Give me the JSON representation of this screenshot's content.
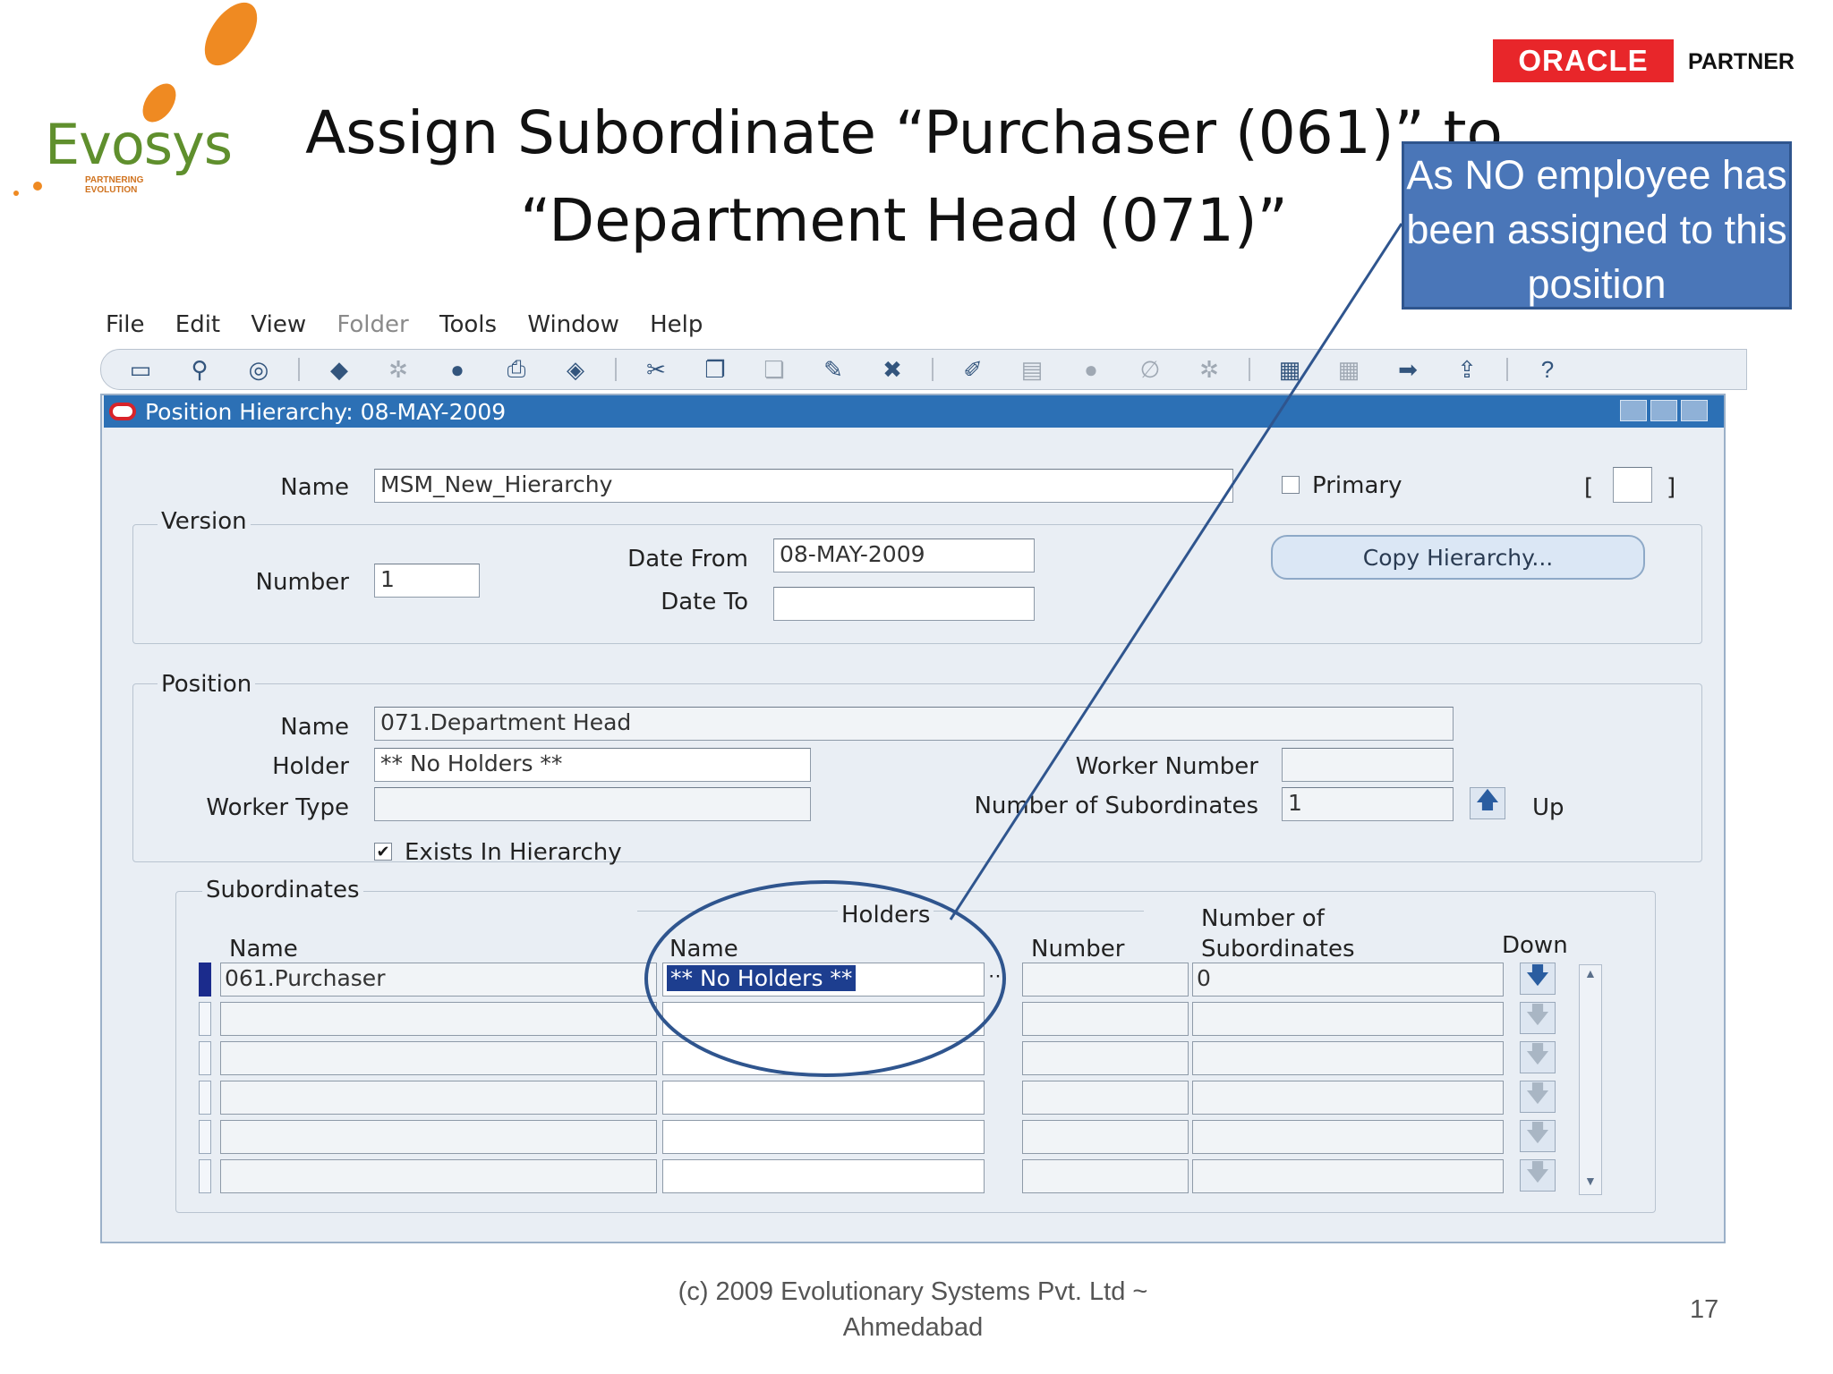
{
  "slide": {
    "title_line1": "Assign Subordinate “Purchaser (061)” to",
    "title_line2": "“Department Head (071)”",
    "logo_text": "Evosys",
    "logo_tagline": "PARTNERING EVOLUTION",
    "oracle_logo": "ORACLE",
    "oracle_partner": "PARTNER",
    "callout": "As NO employee has been assigned to this position",
    "footer_line1": "(c) 2009 Evolutionary Systems Pvt. Ltd ~",
    "footer_line2": "Ahmedabad",
    "page_number": "17"
  },
  "menu": [
    "File",
    "Edit",
    "View",
    "Folder",
    "Tools",
    "Window",
    "Help"
  ],
  "toolbar_icons": [
    "new-record-icon",
    "find-icon",
    "navigator-icon",
    "open-folder-icon",
    "save-icon",
    "switch-responsibility-icon",
    "print-icon",
    "close-form-icon",
    "cut-icon",
    "copy-icon",
    "paste-icon",
    "new-record-icon",
    "delete-record-icon",
    "edit-field-icon",
    "zoom-icon",
    "translations-icon",
    "attachments-icon",
    "folder-tools-icon",
    "calendar-icon",
    "calendar-disabled-icon",
    "window-icon",
    "add-icon",
    "help-icon"
  ],
  "window": {
    "title": "Position Hierarchy: 08-MAY-2009",
    "name_label": "Name",
    "name_value": "MSM_New_Hierarchy",
    "primary_label": "Primary",
    "version": {
      "label": "Version",
      "number_label": "Number",
      "number_value": "1",
      "date_from_label": "Date From",
      "date_from_value": "08-MAY-2009",
      "date_to_label": "Date To",
      "date_to_value": "",
      "copy_button": "Copy Hierarchy..."
    },
    "position": {
      "label": "Position",
      "name_label": "Name",
      "name_value": "071.Department Head",
      "holder_label": "Holder",
      "holder_value": "** No Holders **",
      "worker_type_label": "Worker Type",
      "worker_type_value": "",
      "worker_number_label": "Worker Number",
      "worker_number_value": "",
      "subordinates_label": "Number of Subordinates",
      "subordinates_value": "1",
      "up_label": "Up",
      "exists_label": "Exists In Hierarchy"
    },
    "subordinates": {
      "label": "Subordinates",
      "holders_group": "Holders",
      "col_name": "Name",
      "col_holder_name": "Name",
      "col_number": "Number",
      "col_subs_line1": "Number of",
      "col_subs_line2": "Subordinates",
      "col_down": "Down",
      "rows": [
        {
          "name": "061.Purchaser",
          "holder": "** No Holders **",
          "number": "",
          "subs": "0"
        },
        {
          "name": "",
          "holder": "",
          "number": "",
          "subs": ""
        },
        {
          "name": "",
          "holder": "",
          "number": "",
          "subs": ""
        },
        {
          "name": "",
          "holder": "",
          "number": "",
          "subs": ""
        },
        {
          "name": "",
          "holder": "",
          "number": "",
          "subs": ""
        },
        {
          "name": "",
          "holder": "",
          "number": "",
          "subs": ""
        }
      ]
    }
  }
}
